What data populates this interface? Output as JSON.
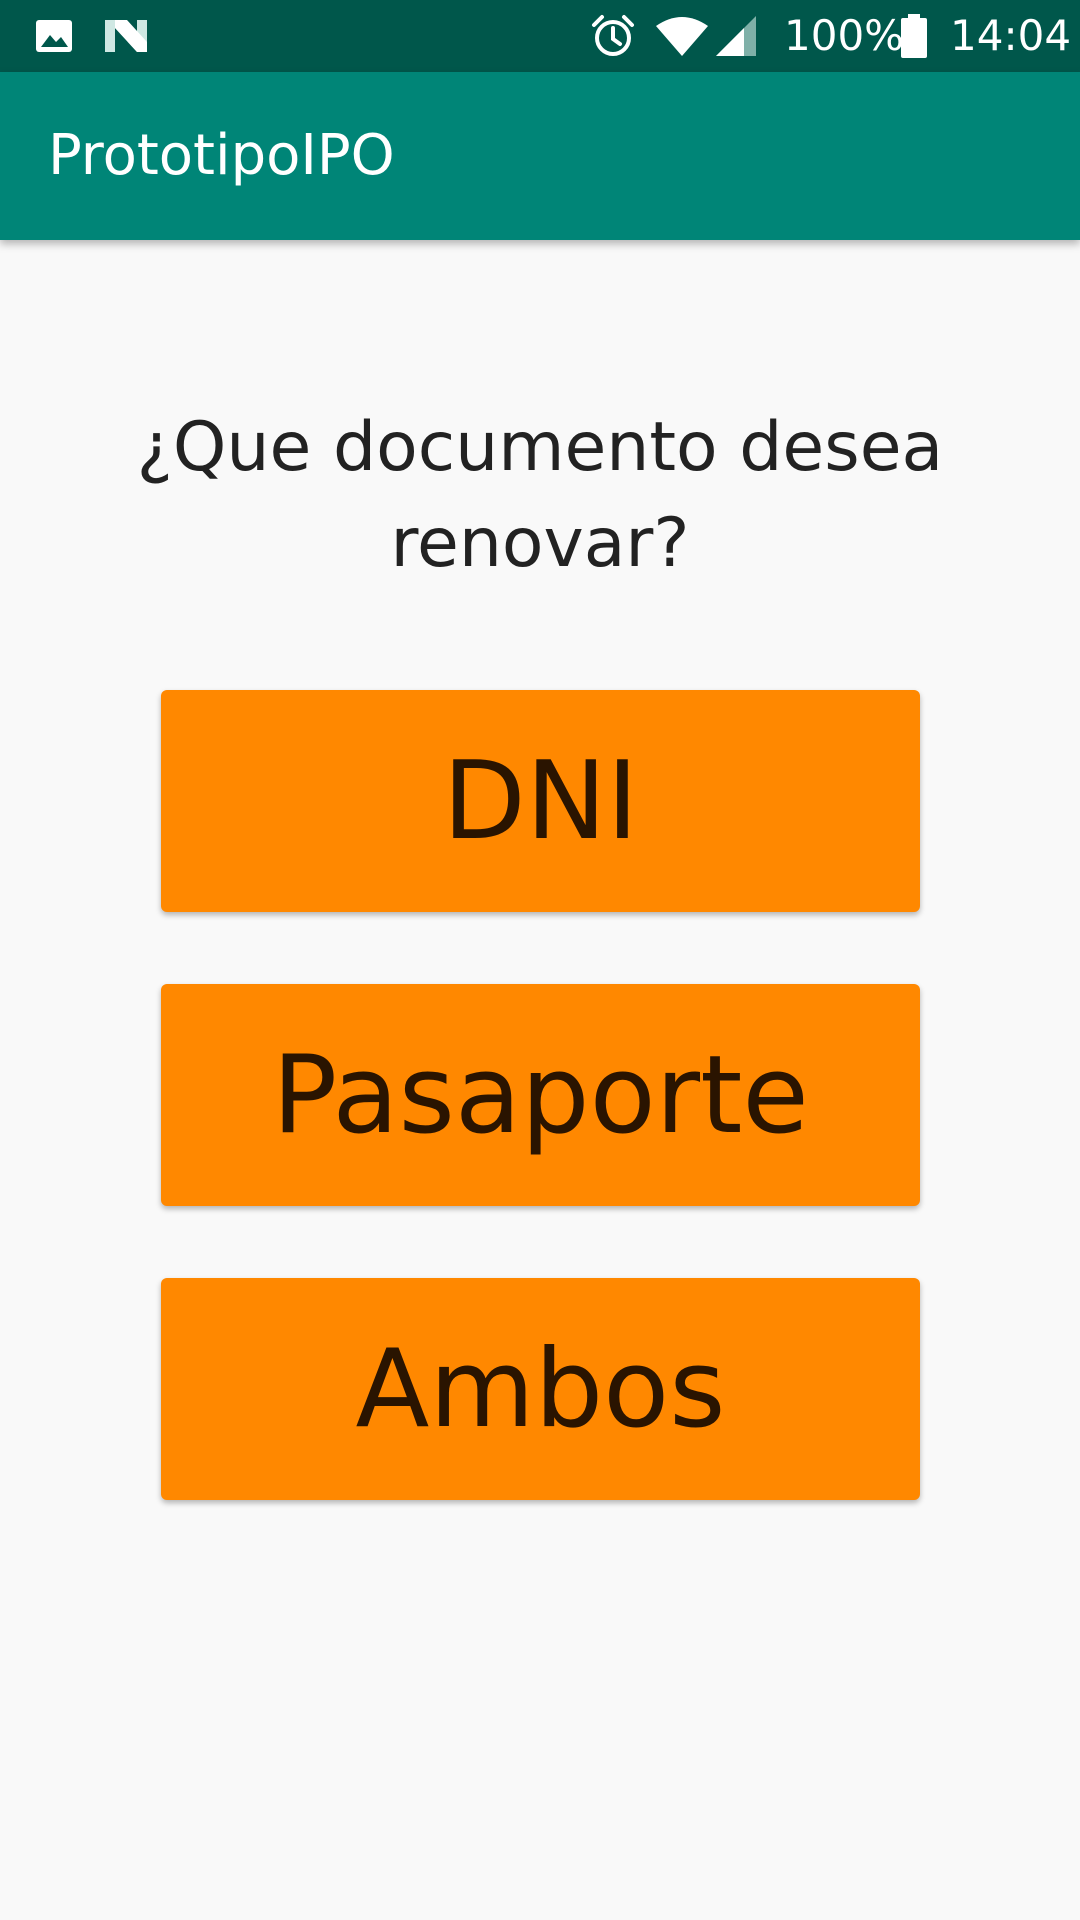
{
  "status_bar": {
    "battery_percent": "100%",
    "clock": "14:04",
    "icons": [
      "gallery-icon",
      "n-logo-icon",
      "alarm-icon",
      "wifi-icon",
      "cell-signal-icon",
      "battery-icon"
    ]
  },
  "app_bar": {
    "title": "PrototipoIPO"
  },
  "main": {
    "question": "¿Que documento desea renovar?",
    "buttons": [
      {
        "label": "DNI"
      },
      {
        "label": "Pasaporte"
      },
      {
        "label": "Ambos"
      }
    ]
  },
  "colors": {
    "status_bar": "#00574b",
    "app_bar": "#008577",
    "button": "#ff8800",
    "button_text": "#2a1400",
    "background": "#f9f9f9"
  }
}
